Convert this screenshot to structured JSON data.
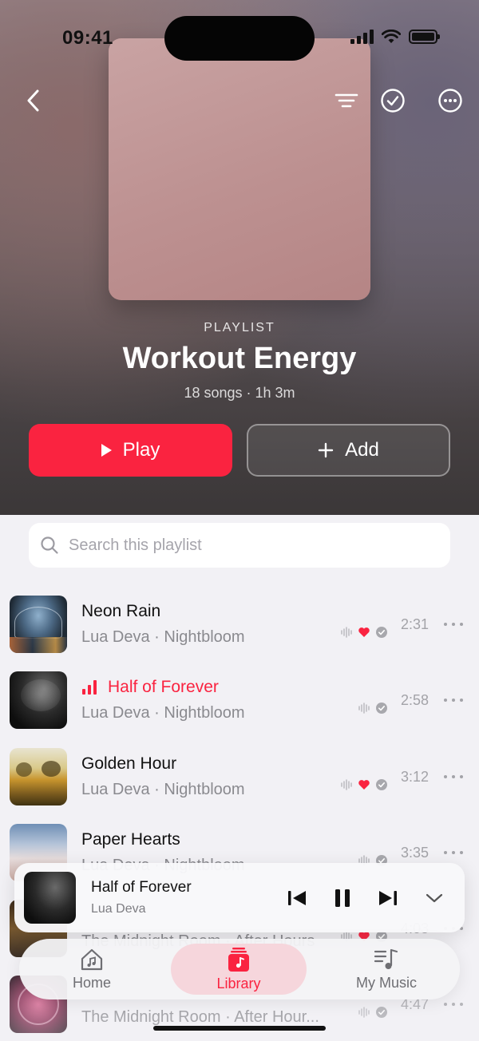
{
  "status": {
    "time": "09:41"
  },
  "playlist": {
    "kind": "PLAYLIST",
    "title": "Workout Energy",
    "meta": "18 songs · 1h 3m",
    "play_label": "Play",
    "add_label": "Add"
  },
  "search": {
    "placeholder": "Search this playlist"
  },
  "songs": [
    {
      "title": "Neon Rain",
      "subtitle": "Lua Deva · Nightbloom",
      "duration": "2:31",
      "liked": true,
      "playing": false
    },
    {
      "title": "Half of Forever",
      "subtitle": "Lua Deva · Nightbloom",
      "duration": "2:58",
      "liked": false,
      "playing": true
    },
    {
      "title": "Golden Hour",
      "subtitle": "Lua Deva · Nightbloom",
      "duration": "3:12",
      "liked": true,
      "playing": false
    },
    {
      "title": "Paper Hearts",
      "subtitle": "Lua Deva · Nightbloom",
      "duration": "3:35",
      "liked": false,
      "playing": false
    },
    {
      "title": "",
      "subtitle": "The Midnight Room · After Hours",
      "duration": "4:03",
      "liked": true,
      "playing": false
    },
    {
      "title": "",
      "subtitle": "The Midnight Room · After Hour...",
      "duration": "4:47",
      "liked": false,
      "playing": false
    }
  ],
  "mini_player": {
    "title": "Half of Forever",
    "artist": "Lua Deva"
  },
  "tabs": [
    {
      "label": "Home",
      "icon": "home-music-icon",
      "active": false
    },
    {
      "label": "Library",
      "icon": "library-music-icon",
      "active": true
    },
    {
      "label": "My Music",
      "icon": "my-music-icon",
      "active": false
    }
  ],
  "colors": {
    "accent": "#fa2340",
    "background": "#f2f1f5"
  }
}
